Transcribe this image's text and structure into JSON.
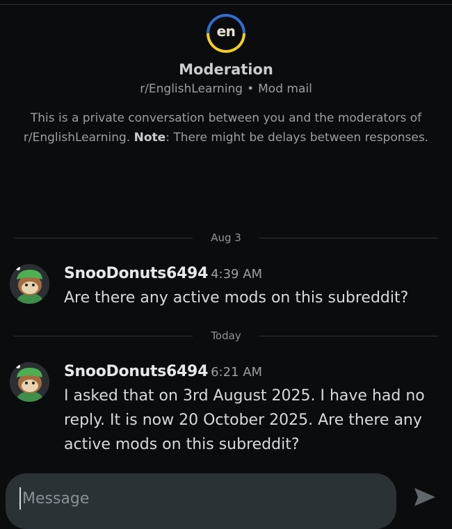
{
  "header": {
    "logo_text": "en",
    "title": "Moderation",
    "subreddit": "r/EnglishLearning",
    "separator": "•",
    "channel": "Mod mail",
    "notice_prefix": "This is a private conversation between you and the moderators of r/EnglishLearning.",
    "notice_bold": "Note",
    "notice_suffix": ": There might be delays between responses."
  },
  "thread": {
    "groups": [
      {
        "date": "Aug 3",
        "messages": [
          {
            "username": "SnooDonuts6494",
            "time": "4:39 AM",
            "text": "Are there any active mods on this subreddit?"
          }
        ]
      },
      {
        "date": "Today",
        "messages": [
          {
            "username": "SnooDonuts6494",
            "time": "6:21 AM",
            "text": "I asked that on 3rd August 2025. I have had no reply. It is now 20 October 2025. Are there any active mods on this subreddit?"
          }
        ]
      }
    ]
  },
  "composer": {
    "placeholder": "Message",
    "value": ""
  },
  "colors": {
    "background": "#0b0c0d",
    "logo_blue": "#2f6fd0",
    "logo_yellow": "#f4cf1f",
    "composer_bg": "#2a3236"
  },
  "icons": {
    "send": "send-arrow-icon",
    "avatar": "snoo-avatar-icon"
  }
}
